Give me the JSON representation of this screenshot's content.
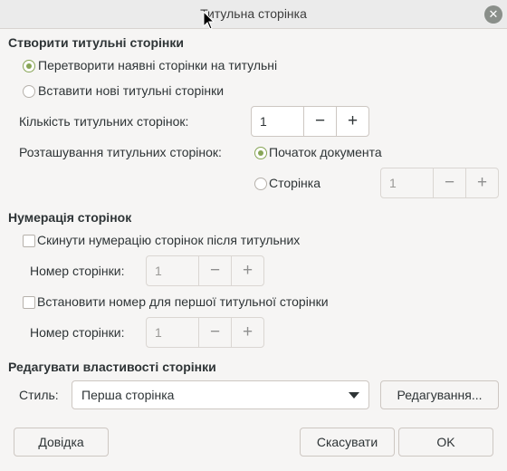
{
  "window": {
    "title": "Титульна сторінка",
    "close_glyph": "✕"
  },
  "create_section": {
    "heading": "Створити титульні сторінки",
    "convert_option": "Перетворити наявні сторінки на титульні",
    "insert_option": "Вставити нові титульні сторінки",
    "count_label": "Кількість титульних сторінок:",
    "count_value": "1",
    "placement_label": "Розташування титульних сторінок:",
    "start_option": "Початок документа",
    "page_option": "Сторінка",
    "page_value": "1"
  },
  "numbering_section": {
    "heading": "Нумерація сторінок",
    "reset_option": "Скинути нумерацію сторінок після титульних",
    "reset_page_label": "Номер сторінки:",
    "reset_page_value": "1",
    "set_option": "Встановити номер для першої титульної сторінки",
    "set_page_label": "Номер сторінки:",
    "set_page_value": "1"
  },
  "properties_section": {
    "heading": "Редагувати властивості сторінки",
    "style_label": "Стиль:",
    "style_value": "Перша сторінка",
    "edit_button": "Редагування..."
  },
  "footer": {
    "help": "Довідка",
    "cancel": "Скасувати",
    "ok": "OK"
  },
  "spin_glyphs": {
    "minus": "−",
    "plus": "+"
  },
  "colors": {
    "accent": "#87a556",
    "background": "#f6f5f4"
  },
  "icons": [
    "close-icon",
    "chevron-down-icon",
    "minus-icon",
    "plus-icon",
    "mouse-cursor-icon"
  ]
}
